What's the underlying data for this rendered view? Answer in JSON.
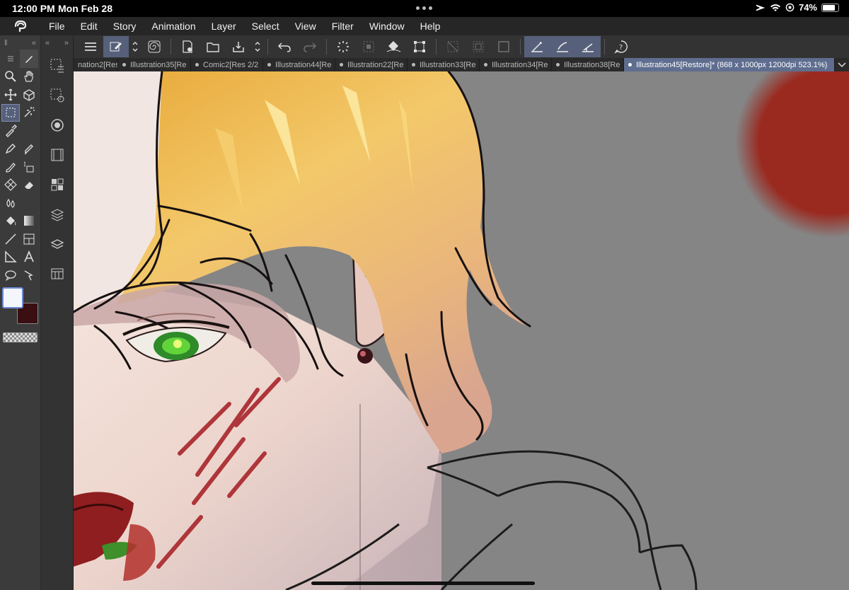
{
  "status_bar": {
    "time": "12:00 PM",
    "date": "Mon Feb 28",
    "battery": "74%"
  },
  "menu": {
    "items": [
      "File",
      "Edit",
      "Story",
      "Animation",
      "Layer",
      "Select",
      "View",
      "Filter",
      "Window",
      "Help"
    ]
  },
  "tabs": [
    {
      "label": "nation2[Res"
    },
    {
      "label": "Illustration35[Re"
    },
    {
      "label": "Comic2[Res 2/2"
    },
    {
      "label": "Illustration44[Re"
    },
    {
      "label": "Illustration22[Re"
    },
    {
      "label": "Illustration33[Re"
    },
    {
      "label": "Illustration34[Re"
    },
    {
      "label": "Illustration38[Re"
    },
    {
      "label": "Illustration45[Restore]* (868 x 1000px 1200dpi 523.1%)"
    }
  ],
  "colors": {
    "accent": "#5f6d8f",
    "main_color": "#f4f6fb",
    "sub_color": "#3a0f12"
  }
}
